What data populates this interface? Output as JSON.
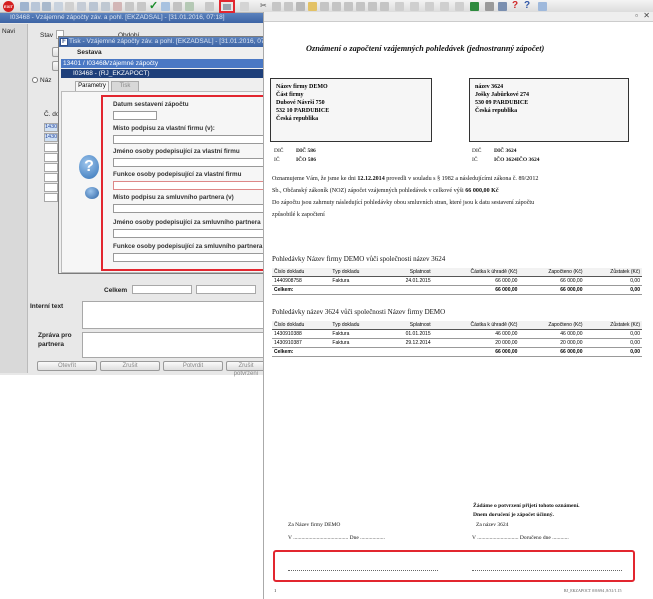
{
  "toolbar": {
    "exit_label": "EXIT"
  },
  "app": {
    "title": "I03468 - Vzájemné zápočty záv. a pohl. [EKZADSAL] - [31.01.2016, 07:18]",
    "status_label": "Stav",
    "sidebar_nav": "Navi",
    "obdobi_label": "Období",
    "nazev_label": "Náz",
    "cislo_label": "Č. do",
    "row1": "1430",
    "row2": "1430",
    "celkem_label": "Celkem",
    "interni_label": "Interní text",
    "zprava_label": "Zpráva pro partnera",
    "buttons": [
      "Otevřít",
      "Zrušit",
      "Potvrdit",
      "Zrušit potvrzení"
    ]
  },
  "modal": {
    "title": "Tisk - Vzájemné zápočty záv. a pohl. [EKZADSAL] - [31.01.2016, 07:18]",
    "sestava_label": "Sestava",
    "row_a_code": "13401 / I03468",
    "row_a_name": "Vzájemné zápočty",
    "row_b": "I03468 - (RJ_EKZAPOCT)",
    "tab_parametry": "Parametry",
    "tab_tisk": "Tisk",
    "fields": [
      "Datum sestavení zápočtu",
      "Místo podpisu za vlastní firmu (v):",
      "Jméno osoby podepisující za vlastní firmu",
      "Funkce osoby podepisující za vlastní firmu",
      "Místo podpisu za smluvního partnera (v)",
      "Jméno osoby podepisující za smluvního partnera",
      "Funkce osoby podepisující za smluvního partnera"
    ]
  },
  "preview": {
    "heading": "Oznámení o započtení vzájemných pohledávek (jednostranný zápočet)",
    "left_box": [
      "Název firmy DEMO",
      "Část firmy",
      "Dubové Návrší 750",
      "532 10 PARDUBICE",
      "Česká republika"
    ],
    "right_box": [
      "název 3624",
      "Jošky Jabůrkové 274",
      "530 09 PARDUBICE",
      "Česká republika"
    ],
    "dic_label": "DIČ",
    "ic_label": "IČ",
    "left_dic": "DIČ 586",
    "left_ic": "IČO 586",
    "right_dic": "DIČ 3624",
    "right_ic": "IČO 3624IČO 3624",
    "body_line1_a": "Oznamujeme Vám, že jsme ke dni ",
    "body_date": "12.12.2014",
    "body_line1_b": " provedli v souladu s § 1982 a následujícími zákona č. 89/2012",
    "body_line2_a": "Sb., Občanský zákoník (NOZ) zápočet vzájemných pohledávek v celkové výši ",
    "body_amount": "66 000,00 Kč",
    "body_line3": "Do zápočtu jsou zahrnuty následující pohledávky obou smluvních stran, které jsou k datu sestavení zápočtu",
    "body_line4": "způsobilé k započtení",
    "section1_title": "Pohledávky Název firmy DEMO vůči společnosti název 3624",
    "section2_title": "Pohledávky název 3624 vůči společnosti Název firmy DEMO",
    "columns": [
      "Číslo dokladu",
      "Typ dokladu",
      "Splatnost",
      "Částka k úhradě (Kč)",
      "Započteno (Kč)",
      "Zůstatek (Kč)"
    ],
    "table1": [
      [
        "1440908758",
        "Faktura",
        "24.01.2015",
        "66 000,00",
        "66 000,00",
        "0,00"
      ]
    ],
    "table1_total": [
      "Celkem:",
      "66 000,00",
      "66 000,00",
      "0,00"
    ],
    "table2": [
      [
        "1430910388",
        "Faktura",
        "01.01.2015",
        "46 000,00",
        "46 000,00",
        "0,00"
      ],
      [
        "1430910387",
        "Faktura",
        "29.12.2014",
        "20 000,00",
        "20 000,00",
        "0,00"
      ]
    ],
    "table2_total": [
      "Celkem:",
      "66 000,00",
      "66 000,00",
      "0,00"
    ],
    "request_line1": "Žádáme o potvrzení přijetí tohoto oznámení.",
    "request_line2": "Dnem doručení je zápočet účinný.",
    "sig_left": "Za Název firmy DEMO",
    "sig_right": "Za název 3624",
    "sig_v": "V",
    "sig_dne": "Dne",
    "sig_doruceno": "Doručeno dne",
    "footer_page": "1",
    "footer_code": "RJ_EKZAPOCT 0/0/694 ,8/31/1.15"
  },
  "colors": {
    "highlight": "#e2262f",
    "title_bar": "#3c63a4",
    "selected_row": "#4a78c4"
  }
}
